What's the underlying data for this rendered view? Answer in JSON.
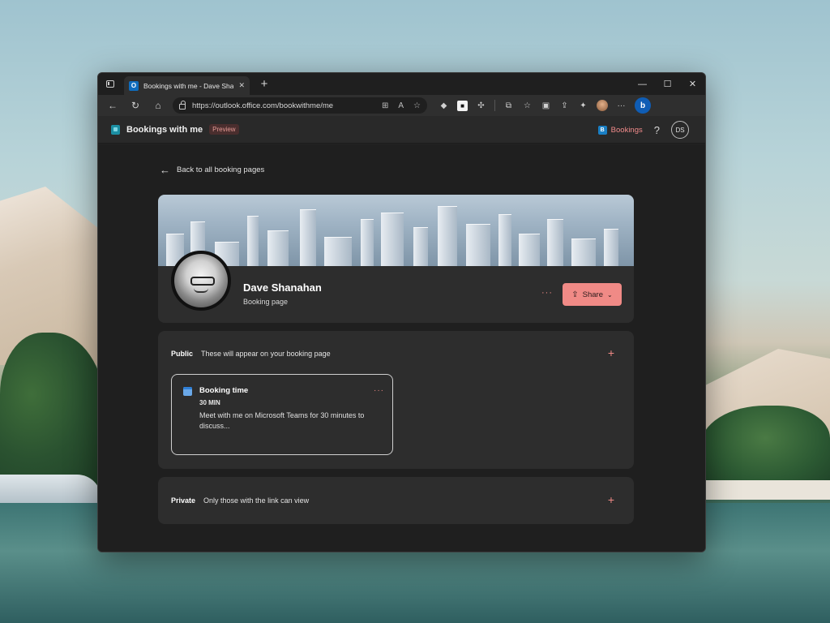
{
  "browser": {
    "tab_title": "Bookings with me - Dave Shanahan",
    "tab_close": "✕",
    "new_tab": "+",
    "url": "https://outlook.office.com/bookwithme/me",
    "controls": {
      "minimize": "—",
      "maximize": "☐",
      "close": "✕"
    }
  },
  "app": {
    "title": "Bookings with me",
    "preview_badge": "Preview",
    "bookings_link": "Bookings",
    "help": "?",
    "user_initials": "DS"
  },
  "content": {
    "back_link": "Back to all booking pages",
    "profile": {
      "name": "Dave Shanahan",
      "subtitle": "Booking page",
      "more": "···",
      "share_label": "Share"
    },
    "public_section": {
      "label": "Public",
      "description": "These will appear on your booking page",
      "add": "+",
      "booking": {
        "title": "Booking time",
        "duration": "30 MIN",
        "description": "Meet with me on Microsoft Teams for 30 minutes to discuss...",
        "more": "···"
      }
    },
    "private_section": {
      "label": "Private",
      "description": "Only those with the link can view",
      "add": "+"
    }
  },
  "colors": {
    "accent": "#f08a86",
    "background": "#1f1f1f",
    "card": "#2d2d2d"
  }
}
